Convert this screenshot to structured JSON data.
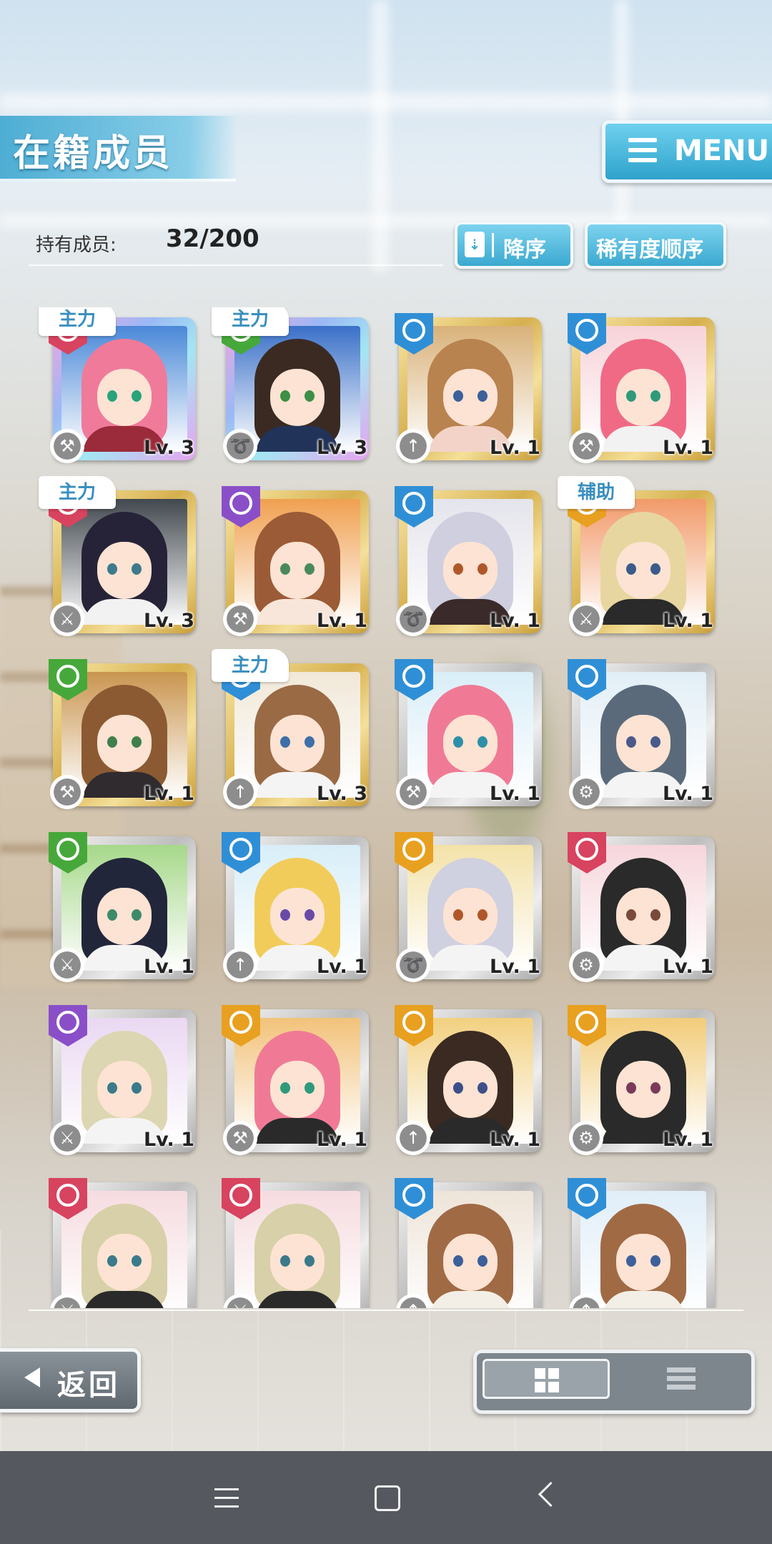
{
  "header": {
    "title": "在籍成员",
    "menu_label": "MENU"
  },
  "members": {
    "count_label": "持有成员:",
    "count_value": "32/200"
  },
  "sort": {
    "order_label": "降序",
    "rarity_label": "稀有度顺序"
  },
  "colors": {
    "accent": "#3ba9d0",
    "frame_gold": "#d6b04e",
    "frame_silver": "#bdbdbd",
    "attr_blue": "#2f8fd6",
    "attr_green": "#46a83a",
    "attr_purple": "#8a4fc8",
    "attr_orange": "#e8a020",
    "attr_pink": "#d8435f"
  },
  "cards": [
    {
      "frame": "rainbow",
      "attr": "pink",
      "type": "hammer-icon",
      "level": "Lv. 3",
      "tag": "主力",
      "hair": "#f07a9a",
      "bg": "#4a88d8",
      "eyes": "#29a37a",
      "outfit": "#9b2a3a"
    },
    {
      "frame": "rainbow",
      "attr": "green",
      "type": "whip-icon",
      "level": "Lv. 3",
      "tag": "主力",
      "hair": "#3a2a22",
      "bg": "#3a70c8",
      "eyes": "#3c8f45",
      "outfit": "#22335a"
    },
    {
      "frame": "gold",
      "attr": "blue",
      "type": "spear-icon",
      "level": "Lv. 1",
      "tag": "",
      "hair": "#b9834f",
      "bg": "#d9b27a",
      "eyes": "#3d5f9a",
      "outfit": "#f3d3c8"
    },
    {
      "frame": "gold",
      "attr": "blue",
      "type": "hammer-icon",
      "level": "Lv. 1",
      "tag": "",
      "hair": "#f06a86",
      "bg": "#f7d3d8",
      "eyes": "#2f9a7a",
      "outfit": "#f2f2f2"
    },
    {
      "frame": "gold",
      "attr": "pink",
      "type": "sword-icon",
      "level": "Lv. 3",
      "tag": "主力",
      "hair": "#262338",
      "bg": "#41484e",
      "eyes": "#3d7a8c",
      "outfit": "#f2f2f2"
    },
    {
      "frame": "gold",
      "attr": "purple",
      "type": "hammer-icon",
      "level": "Lv. 1",
      "tag": "",
      "hair": "#9b5b36",
      "bg": "#f0a050",
      "eyes": "#4a8a5a",
      "outfit": "#f8e6da"
    },
    {
      "frame": "gold",
      "attr": "blue",
      "type": "whip-icon",
      "level": "Lv. 1",
      "tag": "",
      "hair": "#cfcfe0",
      "bg": "#e4e4ec",
      "eyes": "#b0572a",
      "outfit": "#3a2a2a"
    },
    {
      "frame": "gold",
      "attr": "orange",
      "type": "sword-icon",
      "level": "Lv. 1",
      "tag": "辅助",
      "hair": "#e8d6a0",
      "bg": "#f29a6a",
      "eyes": "#3b5b8a",
      "outfit": "#2a2a2a"
    },
    {
      "frame": "gold",
      "attr": "green",
      "type": "hammer-icon",
      "level": "Lv. 1",
      "tag": "",
      "hair": "#8b5a33",
      "bg": "#c9954f",
      "eyes": "#3f7f4a",
      "outfit": "#2f2b2f"
    },
    {
      "frame": "gold",
      "attr": "blue",
      "type": "spear-icon",
      "level": "Lv. 3",
      "tag": "主力",
      "hair": "#9a6a45",
      "bg": "#f1e8d8",
      "eyes": "#3d6fa8",
      "outfit": "#f4f4f4"
    },
    {
      "frame": "silver",
      "attr": "blue",
      "type": "hammer-icon",
      "level": "Lv. 1",
      "tag": "",
      "hair": "#f07a95",
      "bg": "#d9eef8",
      "eyes": "#2f8fa8",
      "outfit": "#f4f4f4"
    },
    {
      "frame": "silver",
      "attr": "blue",
      "type": "gear-icon",
      "level": "Lv. 1",
      "tag": "",
      "hair": "#5a6a7a",
      "bg": "#e2eef6",
      "eyes": "#4a5a8a",
      "outfit": "#f4f4f4"
    },
    {
      "frame": "silver",
      "attr": "green",
      "type": "sword-icon",
      "level": "Lv. 1",
      "tag": "",
      "hair": "#22263a",
      "bg": "#a6d88a",
      "eyes": "#3d8a6a",
      "outfit": "#f4f4f4"
    },
    {
      "frame": "silver",
      "attr": "blue",
      "type": "spear-icon",
      "level": "Lv. 1",
      "tag": "",
      "hair": "#f2cc5a",
      "bg": "#d8eef8",
      "eyes": "#6a4aa8",
      "outfit": "#f4f4f4"
    },
    {
      "frame": "silver",
      "attr": "orange",
      "type": "whip-icon",
      "level": "Lv. 1",
      "tag": "",
      "hair": "#cfd0e0",
      "bg": "#f3e2a8",
      "eyes": "#b0572a",
      "outfit": "#f4f4f4"
    },
    {
      "frame": "silver",
      "attr": "pink",
      "type": "gear-icon",
      "level": "Lv. 1",
      "tag": "",
      "hair": "#2a2a2a",
      "bg": "#f6d6dc",
      "eyes": "#7a4a3a",
      "outfit": "#f4f4f4"
    },
    {
      "frame": "silver",
      "attr": "purple",
      "type": "sword-icon",
      "level": "Lv. 1",
      "tag": "",
      "hair": "#ddd6b2",
      "bg": "#ead8f2",
      "eyes": "#3a7a8a",
      "outfit": "#f4f4f4"
    },
    {
      "frame": "silver",
      "attr": "orange",
      "type": "hammer-icon",
      "level": "Lv. 1",
      "tag": "",
      "hair": "#f07a95",
      "bg": "#f2c27a",
      "eyes": "#2f9a7a",
      "outfit": "#2a2a2a"
    },
    {
      "frame": "silver",
      "attr": "orange",
      "type": "spear-icon",
      "level": "Lv. 1",
      "tag": "",
      "hair": "#3a2a22",
      "bg": "#f2d080",
      "eyes": "#3d4f8a",
      "outfit": "#2a2a2a"
    },
    {
      "frame": "silver",
      "attr": "orange",
      "type": "gear-icon",
      "level": "Lv. 1",
      "tag": "",
      "hair": "#2a2a2a",
      "bg": "#f2cc7a",
      "eyes": "#7a3a5a",
      "outfit": "#2a2a2a"
    },
    {
      "frame": "silver",
      "attr": "pink",
      "type": "sword-icon",
      "level": "",
      "tag": "",
      "hair": "#d8d0a8",
      "bg": "#f6dce0",
      "eyes": "#3a7a8a",
      "outfit": "#2a2a2a"
    },
    {
      "frame": "silver",
      "attr": "pink",
      "type": "sword-icon",
      "level": "",
      "tag": "",
      "hair": "#d8d0a8",
      "bg": "#f6dce0",
      "eyes": "#3a7a8a",
      "outfit": "#2a2a2a"
    },
    {
      "frame": "silver",
      "attr": "blue",
      "type": "spear-icon",
      "level": "",
      "tag": "",
      "hair": "#a06a45",
      "bg": "#eee4d8",
      "eyes": "#3d5f9a",
      "outfit": "#f3efe6"
    },
    {
      "frame": "silver",
      "attr": "blue",
      "type": "spear-icon",
      "level": "",
      "tag": "",
      "hair": "#a06a45",
      "bg": "#e0eef8",
      "eyes": "#3d5f9a",
      "outfit": "#f3efe6"
    }
  ],
  "footer": {
    "back_label": "返回",
    "view_grid": "grid-view-icon",
    "view_list": "list-view-icon"
  },
  "system_nav": {
    "menu": "recent-apps-icon",
    "home": "home-icon",
    "back": "back-icon"
  }
}
